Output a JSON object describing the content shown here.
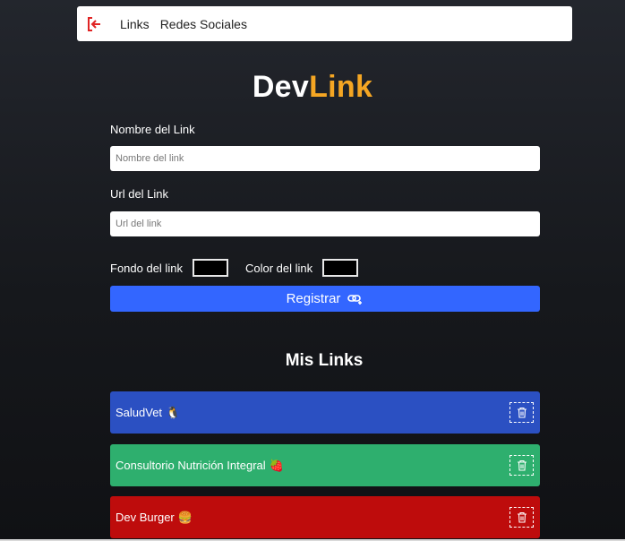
{
  "nav": {
    "logout_icon": "logout-icon",
    "links_label": "Links",
    "social_label": "Redes Sociales"
  },
  "logo": {
    "part1": "Dev",
    "part2": "Link",
    "accent_color": "#f5a623"
  },
  "form": {
    "name_label": "Nombre del Link",
    "name_placeholder": "Nombre del link",
    "name_value": "",
    "url_label": "Url del Link",
    "url_placeholder": "Url del link",
    "url_value": "",
    "bg_label": "Fondo del link",
    "bg_value": "#000000",
    "color_label": "Color del link",
    "color_value": "#000000",
    "submit_label": "Registrar",
    "submit_icon": "link-add-icon",
    "submit_color": "#3366ff"
  },
  "links_section": {
    "title": "Mis Links",
    "items": [
      {
        "name": "SaludVet",
        "emoji": "🐧",
        "bg": "#2b50c2",
        "delete_icon": "trash-icon"
      },
      {
        "name": "Consultorio Nutrición Integral",
        "emoji": "🍓",
        "bg": "#2eaf6e",
        "delete_icon": "trash-icon"
      },
      {
        "name": "Dev Burger",
        "emoji": "🍔",
        "bg": "#be0c0c",
        "delete_icon": "trash-icon"
      }
    ]
  }
}
